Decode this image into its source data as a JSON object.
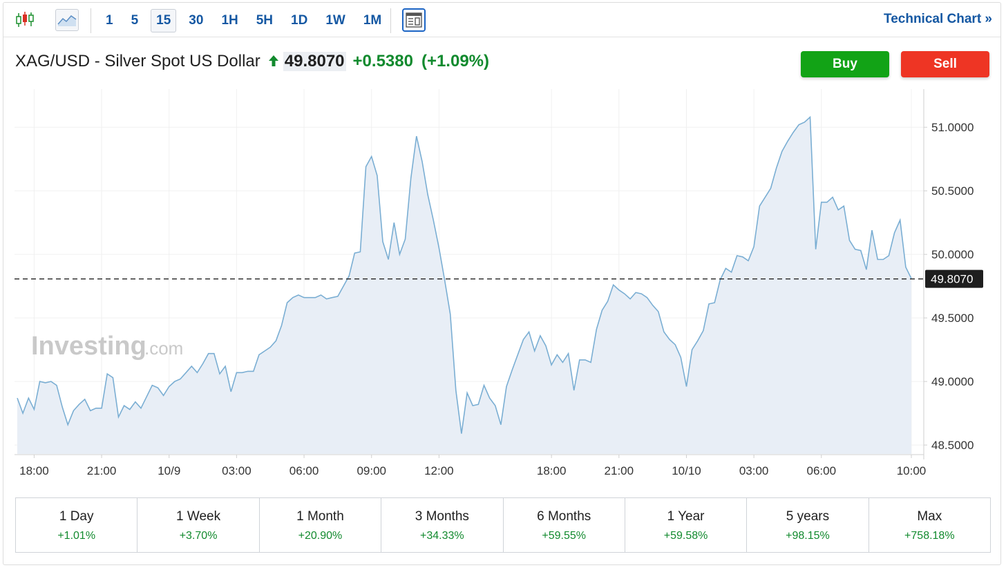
{
  "toolbar": {
    "intervals": [
      {
        "label": "1",
        "active": false
      },
      {
        "label": "5",
        "active": false
      },
      {
        "label": "15",
        "active": true
      },
      {
        "label": "30",
        "active": false
      },
      {
        "label": "1H",
        "active": false
      },
      {
        "label": "5H",
        "active": false
      },
      {
        "label": "1D",
        "active": false
      },
      {
        "label": "1W",
        "active": false
      },
      {
        "label": "1M",
        "active": false
      }
    ],
    "technical_chart_label": "Technical Chart »",
    "icons": [
      "candlestick-icon",
      "line-chart-icon",
      "chart-template-icon"
    ]
  },
  "instrument": {
    "name": "XAG/USD - Silver Spot US Dollar",
    "price": "49.8070",
    "change": "+0.5380",
    "change_pct": "(+1.09%)"
  },
  "actions": {
    "buy_label": "Buy",
    "sell_label": "Sell"
  },
  "colors": {
    "accent_blue": "#1558a3",
    "positive_green": "#128a2e",
    "buy_green": "#12a316",
    "sell_red": "#ee3524",
    "line": "#7aaed3",
    "area": "#e8eef6"
  },
  "watermark": {
    "brand": "Investing",
    "suffix": ".com"
  },
  "chart_data": {
    "type": "area",
    "yticks": [
      "51.0000",
      "50.5000",
      "50.0000",
      "49.5000",
      "49.0000",
      "48.5000"
    ],
    "ytick_values": [
      51.0,
      50.5,
      50.0,
      49.5,
      49.0,
      48.5
    ],
    "ylim": [
      48.43,
      51.3
    ],
    "xticks": [
      {
        "label": "18:00",
        "i": 3
      },
      {
        "label": "21:00",
        "i": 15
      },
      {
        "label": "10/9",
        "i": 27
      },
      {
        "label": "03:00",
        "i": 39
      },
      {
        "label": "06:00",
        "i": 51
      },
      {
        "label": "09:00",
        "i": 63
      },
      {
        "label": "12:00",
        "i": 75
      },
      {
        "label": "18:00",
        "i": 95
      },
      {
        "label": "21:00",
        "i": 107
      },
      {
        "label": "10/10",
        "i": 119
      },
      {
        "label": "03:00",
        "i": 131
      },
      {
        "label": "06:00",
        "i": 143
      },
      {
        "label": "10:00",
        "i": 159
      }
    ],
    "last_price": 49.807,
    "last_price_label": "49.8070",
    "values": [
      48.87,
      48.75,
      48.87,
      48.78,
      49.0,
      48.99,
      49.0,
      48.97,
      48.8,
      48.66,
      48.77,
      48.82,
      48.86,
      48.77,
      48.79,
      48.79,
      49.06,
      49.03,
      48.72,
      48.81,
      48.78,
      48.84,
      48.79,
      48.88,
      48.97,
      48.95,
      48.89,
      48.96,
      49.0,
      49.02,
      49.07,
      49.12,
      49.07,
      49.14,
      49.22,
      49.22,
      49.06,
      49.12,
      48.92,
      49.07,
      49.07,
      49.08,
      49.08,
      49.21,
      49.24,
      49.27,
      49.32,
      49.44,
      49.62,
      49.66,
      49.68,
      49.66,
      49.66,
      49.66,
      49.68,
      49.65,
      49.66,
      49.67,
      49.75,
      49.83,
      50.01,
      50.02,
      50.69,
      50.77,
      50.62,
      50.1,
      49.96,
      50.25,
      50.0,
      50.12,
      50.6,
      50.93,
      50.73,
      50.47,
      50.27,
      50.05,
      49.8,
      49.53,
      48.93,
      48.59,
      48.91,
      48.81,
      48.82,
      48.97,
      48.87,
      48.81,
      48.66,
      48.96,
      49.09,
      49.21,
      49.33,
      49.39,
      49.24,
      49.36,
      49.28,
      49.13,
      49.21,
      49.15,
      49.22,
      48.93,
      49.17,
      49.17,
      49.15,
      49.41,
      49.56,
      49.63,
      49.76,
      49.72,
      49.69,
      49.65,
      49.7,
      49.69,
      49.66,
      49.6,
      49.55,
      49.39,
      49.33,
      49.29,
      49.19,
      48.96,
      49.25,
      49.32,
      49.4,
      49.61,
      49.62,
      49.8,
      49.89,
      49.86,
      49.99,
      49.98,
      49.95,
      50.06,
      50.38,
      50.45,
      50.52,
      50.68,
      50.81,
      50.89,
      50.96,
      51.02,
      51.04,
      51.08,
      50.04,
      50.41,
      50.41,
      50.45,
      50.35,
      50.38,
      50.11,
      50.04,
      50.03,
      49.88,
      50.19,
      49.96,
      49.96,
      49.99,
      50.17,
      50.27,
      49.9,
      49.81
    ]
  },
  "periods": [
    {
      "label": "1 Day",
      "value": "+1.01%"
    },
    {
      "label": "1 Week",
      "value": "+3.70%"
    },
    {
      "label": "1 Month",
      "value": "+20.90%"
    },
    {
      "label": "3 Months",
      "value": "+34.33%"
    },
    {
      "label": "6 Months",
      "value": "+59.55%"
    },
    {
      "label": "1 Year",
      "value": "+59.58%"
    },
    {
      "label": "5 years",
      "value": "+98.15%"
    },
    {
      "label": "Max",
      "value": "+758.18%"
    }
  ]
}
